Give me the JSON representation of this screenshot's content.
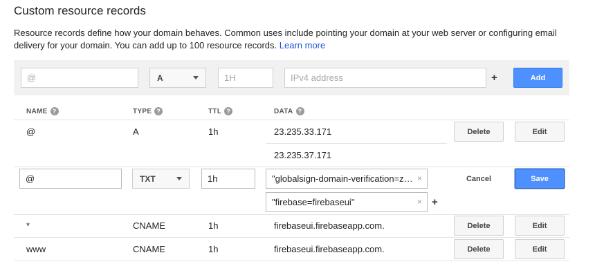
{
  "title": "Custom resource records",
  "description": "Resource records define how your domain behaves. Common uses include pointing your domain at your web server or configuring email delivery for your domain. You can add up to 100 resource records.",
  "learn_more": "Learn more",
  "add_form": {
    "name_placeholder": "@",
    "type_value": "A",
    "ttl_placeholder": "1H",
    "data_placeholder": "IPv4 address",
    "plus": "+",
    "add_label": "Add"
  },
  "columns": {
    "name": "NAME",
    "type": "TYPE",
    "ttl": "TTL",
    "data": "DATA",
    "help": "?"
  },
  "records": [
    {
      "name": "@",
      "type": "A",
      "ttl": "1h",
      "data": [
        "23.235.33.171",
        "23.235.37.171"
      ],
      "delete_label": "Delete",
      "edit_label": "Edit"
    },
    {
      "name": "*",
      "type": "CNAME",
      "ttl": "1h",
      "data": [
        "firebaseui.firebaseapp.com."
      ],
      "delete_label": "Delete",
      "edit_label": "Edit"
    },
    {
      "name": "www",
      "type": "CNAME",
      "ttl": "1h",
      "data": [
        "firebaseui.firebaseapp.com."
      ],
      "delete_label": "Delete",
      "edit_label": "Edit"
    }
  ],
  "editing_row": {
    "name": "@",
    "type": "TXT",
    "ttl": "1h",
    "data": [
      "\"globalsign-domain-verification=z…",
      "\"firebase=firebaseui\""
    ],
    "clear": "×",
    "plus": "+",
    "cancel_label": "Cancel",
    "save_label": "Save"
  },
  "colors": {
    "primary_button": "#4d90fe",
    "link": "#1a55d6",
    "add_bar_bg": "#f1f1f1"
  },
  "icons": {
    "help": "help-circle-icon",
    "clear": "clear-x-icon",
    "dropdown": "chevron-down-icon"
  }
}
